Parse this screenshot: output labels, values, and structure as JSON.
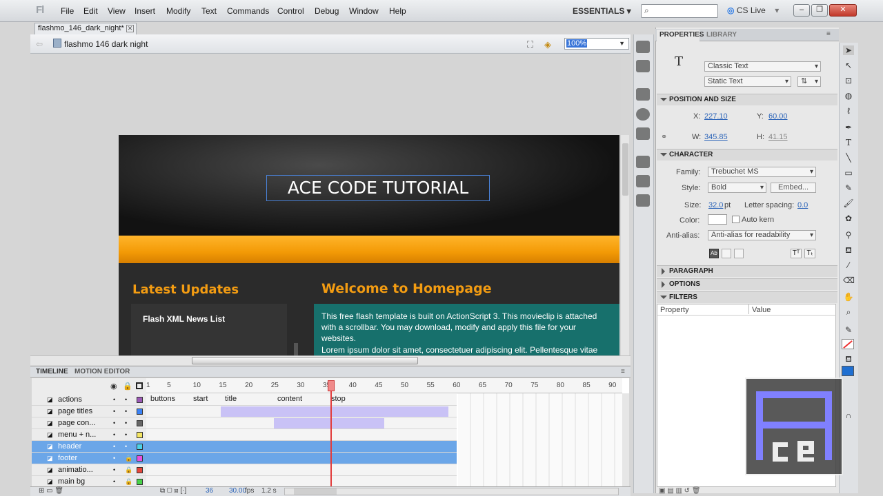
{
  "app": {
    "logo": "Fl"
  },
  "menu": [
    "File",
    "Edit",
    "View",
    "Insert",
    "Modify",
    "Text",
    "Commands",
    "Control",
    "Debug",
    "Window",
    "Help"
  ],
  "workspace": {
    "essentials": "ESSENTIALS ▾",
    "cslive": "CS Live"
  },
  "window_controls": {
    "minimize": "–",
    "restore": "❐",
    "close": "✕"
  },
  "document": {
    "tab": "flashmo_146_dark_night*",
    "scene": "flashmo 146 dark night",
    "zoom": "100%"
  },
  "stage": {
    "title": "ACE CODE TUTORIAL",
    "latest_updates": "Latest Updates",
    "news_title": "Flash XML News List",
    "welcome_title": "Welcome to Homepage",
    "welcome_text": "This free flash template is built on ActionScript 3. This movieclip is attached with a scrollbar. You may download, modify and apply this file for your websites.",
    "lorem_text": "Lorem ipsum dolor sit amet, consectetuer adipiscing elit. Pellentesque vitae"
  },
  "properties": {
    "tab_properties": "PROPERTIES",
    "tab_library": "LIBRARY",
    "text_icon": "T",
    "text_engine": "Classic Text",
    "text_type": "Static Text",
    "position_size": {
      "header": "POSITION AND SIZE",
      "x_label": "X:",
      "x": "227.10",
      "y_label": "Y:",
      "y": "60.00",
      "w_label": "W:",
      "w": "345.85",
      "h_label": "H:",
      "h": "41.15"
    },
    "character": {
      "header": "CHARACTER",
      "family_label": "Family:",
      "family": "Trebuchet MS",
      "style_label": "Style:",
      "style": "Bold",
      "embed": "Embed...",
      "size_label": "Size:",
      "size": "32.0",
      "size_unit": "pt",
      "spacing_label": "Letter spacing:",
      "spacing": "0.0",
      "color_label": "Color:",
      "auto_kern": "Auto kern",
      "antialias_label": "Anti-alias:",
      "antialias": "Anti-alias for readability"
    },
    "paragraph": "PARAGRAPH",
    "options": "OPTIONS",
    "filters": "FILTERS",
    "filter_col_property": "Property",
    "filter_col_value": "Value"
  },
  "timeline": {
    "tab_timeline": "TIMELINE",
    "tab_motion": "MOTION EDITOR",
    "ruler": [
      "1",
      "5",
      "10",
      "15",
      "20",
      "25",
      "30",
      "35",
      "40",
      "45",
      "50",
      "55",
      "60",
      "65",
      "70",
      "75",
      "80",
      "85",
      "90"
    ],
    "layers": [
      {
        "name": "actions",
        "color": "#9b59b6",
        "selected": false
      },
      {
        "name": "page titles",
        "color": "#3b82f6",
        "selected": false
      },
      {
        "name": "page con...",
        "color": "#666666",
        "selected": false
      },
      {
        "name": "menu + n...",
        "color": "#f5e663",
        "selected": false
      },
      {
        "name": "header",
        "color": "#4dd2e8",
        "selected": true
      },
      {
        "name": "footer",
        "color": "#e94fe0",
        "selected": true
      },
      {
        "name": "animatio...",
        "color": "#e8463b",
        "selected": false
      },
      {
        "name": "main bg",
        "color": "#48d248",
        "selected": false
      }
    ],
    "frame_labels": [
      "buttons",
      "start",
      "title",
      "content",
      "stop"
    ],
    "status": {
      "frame": "36",
      "fps": "30.00",
      "fps_unit": "fps",
      "time": "1.2 s"
    }
  }
}
